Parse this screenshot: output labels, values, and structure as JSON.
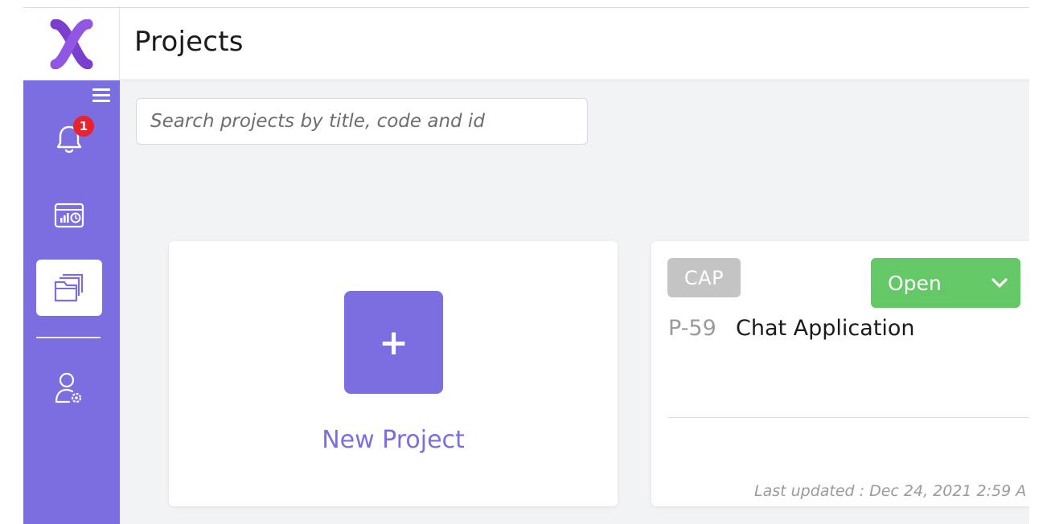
{
  "app": {
    "logo_icon": "x-logo-icon",
    "brand_color": "#7a6ee0"
  },
  "header": {
    "title": "Projects"
  },
  "sidebar": {
    "menu_icon": "hamburger-menu-icon",
    "notifications_badge": "1",
    "items": [
      {
        "name": "notifications",
        "icon": "bell-icon"
      },
      {
        "name": "dashboard",
        "icon": "dashboard-chart-icon"
      },
      {
        "name": "projects",
        "icon": "folders-icon",
        "active": true
      },
      {
        "name": "user-settings",
        "icon": "user-gear-icon"
      }
    ]
  },
  "search": {
    "placeholder": "Search projects by title, code and id",
    "value": ""
  },
  "new_project": {
    "icon": "plus-icon",
    "plus_glyph": "+",
    "label": "New Project"
  },
  "project": {
    "tag": "CAP",
    "status": "Open",
    "status_color": "#65c867",
    "code": "P-59",
    "title": "Chat Application",
    "last_updated": "Last updated : Dec 24, 2021 2:59 A"
  }
}
